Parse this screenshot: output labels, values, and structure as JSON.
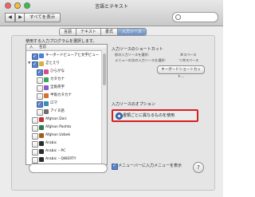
{
  "window": {
    "title": "言語とテキスト",
    "show_all": "すべてを表示",
    "search_placeholder": ""
  },
  "tabs": [
    {
      "label": "言語",
      "selected": false
    },
    {
      "label": "テキスト",
      "selected": false
    },
    {
      "label": "書式",
      "selected": false
    },
    {
      "label": "入力ソース",
      "selected": true
    }
  ],
  "left_panel": {
    "instruction": "使用する入力プログラムを選択します。",
    "header": {
      "col_on": "入",
      "col_name": "名前"
    },
    "items": [
      {
        "label": "キーボードビューアと文字ビューア",
        "checked": true,
        "kind": "item"
      },
      {
        "label": "ことえり",
        "checked": true,
        "kind": "group"
      },
      {
        "label": "ひらがな",
        "checked": true,
        "kind": "item"
      },
      {
        "label": "カタカナ",
        "checked": false,
        "kind": "item"
      },
      {
        "label": "全角英字",
        "checked": false,
        "kind": "item"
      },
      {
        "label": "半角カタカナ",
        "checked": false,
        "kind": "item"
      },
      {
        "label": "ロマ",
        "checked": true,
        "kind": "item"
      },
      {
        "label": "アイヌ語",
        "checked": false,
        "kind": "item"
      },
      {
        "label": "Afghan Dari",
        "checked": false,
        "kind": "item"
      },
      {
        "label": "Afghan Pashto",
        "checked": false,
        "kind": "item"
      },
      {
        "label": "Afghan Uzbek",
        "checked": false,
        "kind": "item"
      },
      {
        "label": "Arabic",
        "checked": false,
        "kind": "item"
      },
      {
        "label": "Arabic – PC",
        "checked": false,
        "kind": "item"
      },
      {
        "label": "Arabic – QWERTY",
        "checked": false,
        "kind": "item"
      }
    ]
  },
  "shortcuts": {
    "title": "入力ソースのショートカット",
    "prev_label": "前の入力ソースを選択:",
    "prev_key": "⌘スペース",
    "next_label": "メニューの次の入力ソースを選択:",
    "next_key": "⌥⌘スペース",
    "button": "キーボードショートカット..."
  },
  "options": {
    "title": "入力ソースのオプション",
    "selected_option": "書類ごとに異なるものを使用"
  },
  "footer": {
    "show_in_menu": "メニューバーに入力メニューを表示",
    "help": "?"
  },
  "colors": {
    "accent": "#5a83c5",
    "highlight_red": "#d92020"
  }
}
